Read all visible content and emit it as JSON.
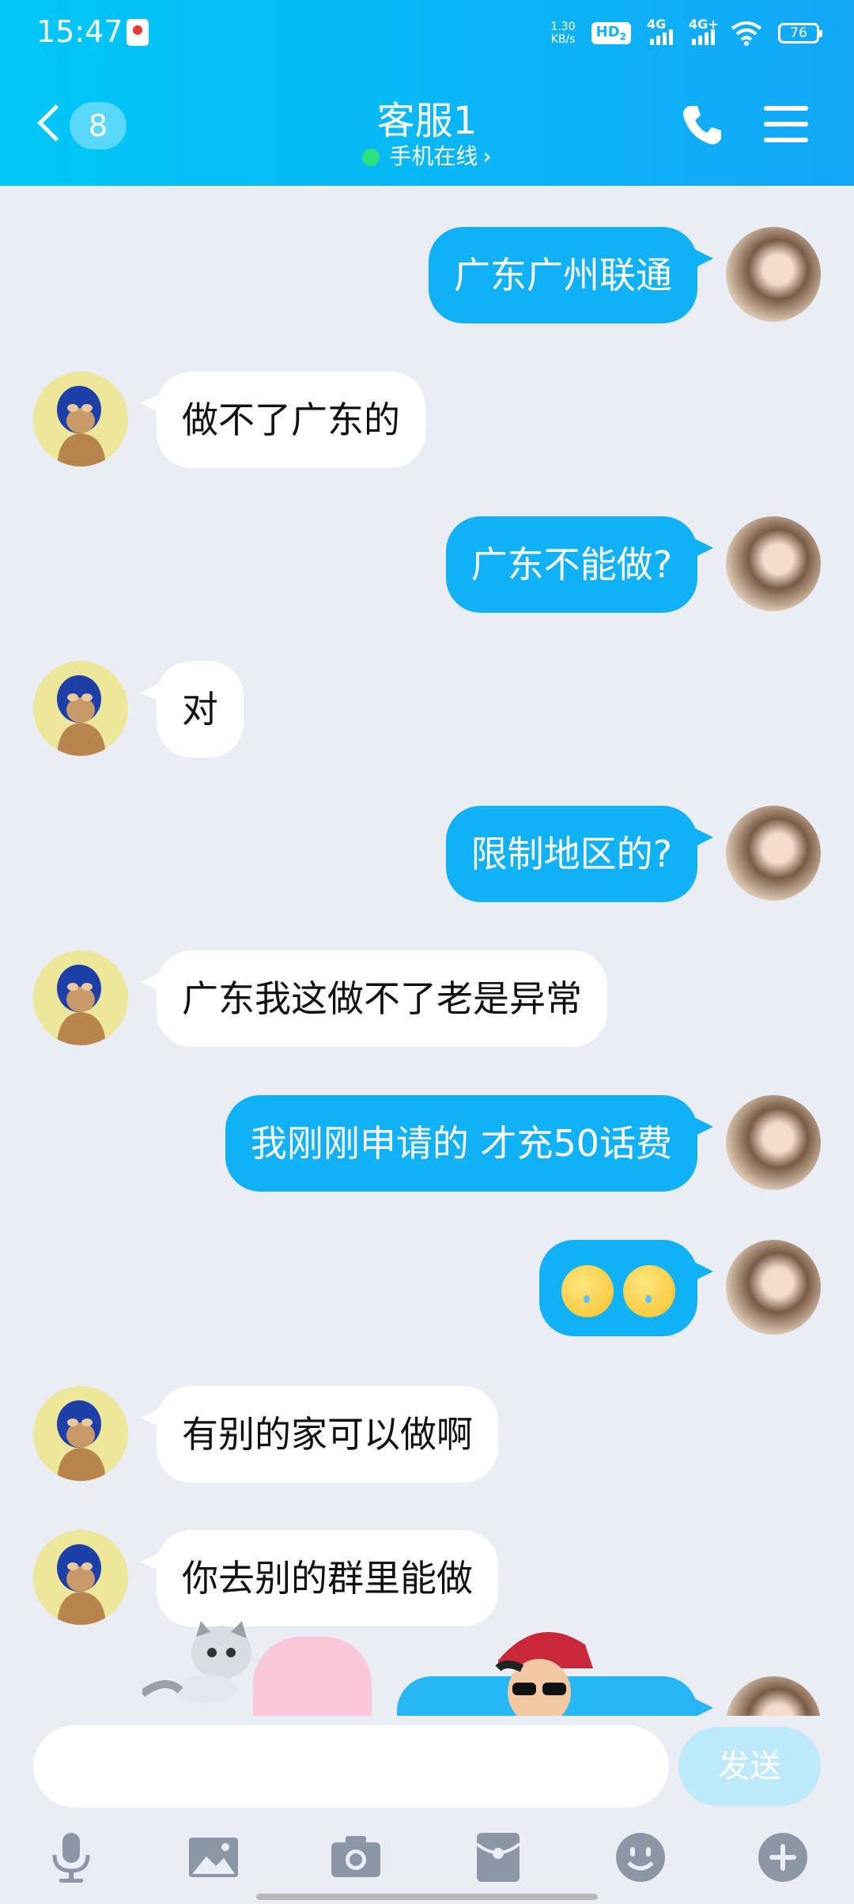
{
  "status_bar": {
    "time": "15:47",
    "speed_value": "1.30",
    "speed_unit": "KB/s",
    "hd_label": "HD",
    "hd_sub": "2",
    "signal1_label": "4G",
    "signal2_label": "4G+",
    "battery": "76"
  },
  "header": {
    "back_badge": "8",
    "title": "客服1",
    "subtitle": "手机在线",
    "subtitle_chevron": "›"
  },
  "messages": [
    {
      "sender": "me",
      "text": "广东广州联通"
    },
    {
      "sender": "cs",
      "text": "做不了广东的"
    },
    {
      "sender": "me",
      "text": "广东不能做?"
    },
    {
      "sender": "cs",
      "text": "对"
    },
    {
      "sender": "me",
      "text": "限制地区的?"
    },
    {
      "sender": "cs",
      "text": "广东我这做不了老是异常"
    },
    {
      "sender": "me",
      "text": "我刚刚申请的 才充50话费"
    },
    {
      "sender": "me",
      "text": ""
    },
    {
      "sender": "cs",
      "text": "有别的家可以做啊"
    },
    {
      "sender": "cs",
      "text": "你去别的群里能做"
    }
  ],
  "input": {
    "placeholder": "",
    "send_label": "发送"
  },
  "toolbar": [
    "microphone-icon",
    "image-icon",
    "camera-icon",
    "red-packet-icon",
    "emoji-icon",
    "plus-icon"
  ]
}
